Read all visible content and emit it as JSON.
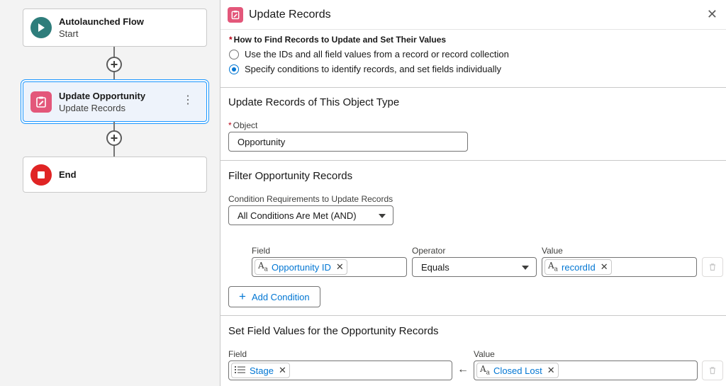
{
  "canvas": {
    "start_node": {
      "title": "Autolaunched Flow",
      "subtitle": "Start"
    },
    "update_node": {
      "title": "Update Opportunity",
      "subtitle": "Update Records"
    },
    "end_node": {
      "title": "End"
    }
  },
  "panel": {
    "title": "Update Records",
    "how_to": {
      "label": "How to Find Records to Update and Set Their Values",
      "options": [
        {
          "label": "Use the IDs and all field values from a record or record collection",
          "selected": false
        },
        {
          "label": "Specify conditions to identify records, and set fields individually",
          "selected": true
        }
      ]
    },
    "object_section": {
      "title": "Update Records of This Object Type",
      "object_label": "Object",
      "object_value": "Opportunity"
    },
    "filter_section": {
      "title": "Filter Opportunity Records",
      "requirements_label": "Condition Requirements to Update Records",
      "requirements_value": "All Conditions Are Met (AND)",
      "headers": {
        "field": "Field",
        "operator": "Operator",
        "value": "Value"
      },
      "condition": {
        "field": "Opportunity ID",
        "operator": "Equals",
        "value": "recordId"
      },
      "add_condition_label": "Add Condition"
    },
    "set_section": {
      "title": "Set Field Values for the Opportunity Records",
      "headers": {
        "field": "Field",
        "value": "Value"
      },
      "row": {
        "field": "Stage",
        "value": "Closed Lost"
      }
    }
  },
  "colors": {
    "accent": "#0176d3",
    "start_icon": "#2e7d7b",
    "update_icon": "#e3577a",
    "end_icon": "#e02424"
  }
}
